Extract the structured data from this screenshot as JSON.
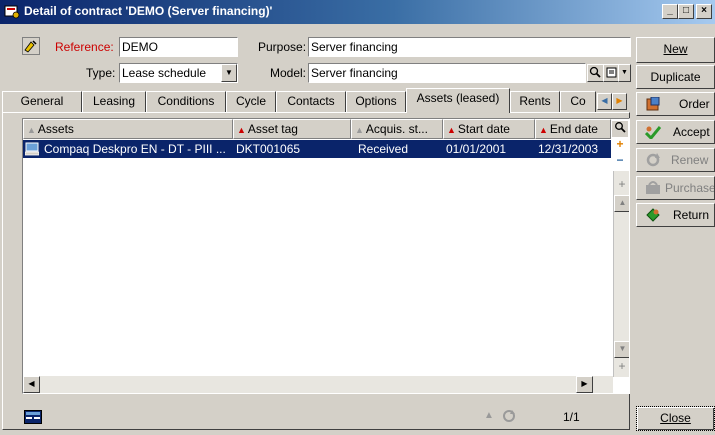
{
  "window": {
    "title": "Detail of contract 'DEMO (Server financing)'",
    "controls": [
      "_",
      "□",
      "×"
    ]
  },
  "fields": {
    "reference_label": "Reference:",
    "reference_value": "DEMO",
    "purpose_label": "Purpose:",
    "purpose_value": "Server financing",
    "type_label": "Type:",
    "type_value": "Lease schedule",
    "model_label": "Model:",
    "model_value": "Server financing"
  },
  "tabs": [
    {
      "label": "General"
    },
    {
      "label": "Leasing"
    },
    {
      "label": "Conditions"
    },
    {
      "label": "Cycle"
    },
    {
      "label": "Contacts"
    },
    {
      "label": "Options"
    },
    {
      "label": "Assets (leased)",
      "active": true
    },
    {
      "label": "Rents"
    },
    {
      "label": "Co"
    }
  ],
  "list": {
    "columns": [
      "Assets",
      "Asset tag",
      "Acquis. st...",
      "Start date",
      "End date"
    ],
    "rows": [
      {
        "assets": "Compaq Deskpro EN - DT - PIII ...",
        "asset_tag": "DKT001065",
        "acquis_status": "Received",
        "start_date": "01/01/2001",
        "end_date": "12/31/2003"
      }
    ],
    "counter": "1/1"
  },
  "actions": {
    "new": "New",
    "duplicate": "Duplicate",
    "order": "Order",
    "accept": "Accept",
    "renew": "Renew",
    "purchase": "Purchase",
    "return": "Return",
    "close": "Close"
  },
  "colors": {
    "titlebar": "#0a246a",
    "selection": "#0a246a",
    "sort_indicator": "#cc0000"
  }
}
